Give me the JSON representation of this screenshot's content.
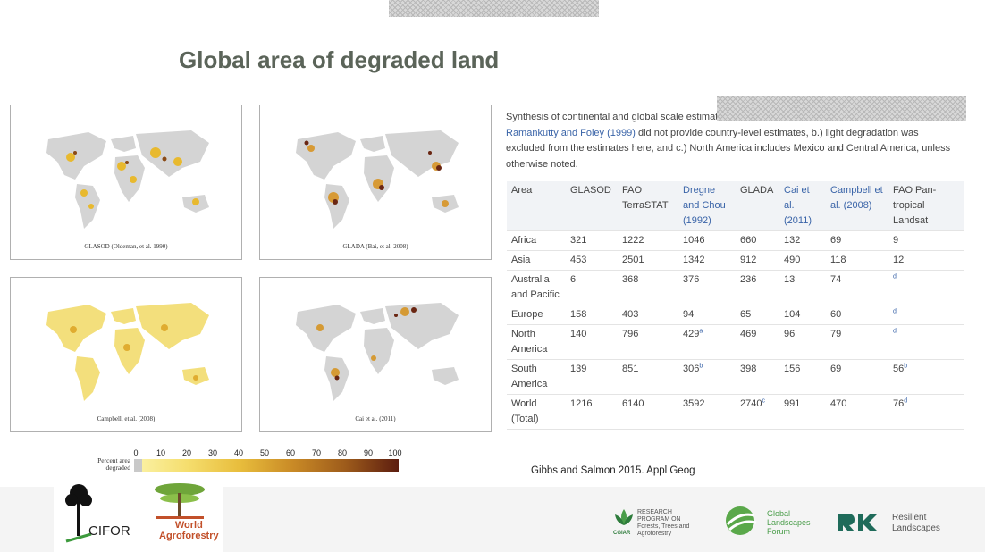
{
  "title": "Global area of degraded land",
  "maps": [
    {
      "label": "GLASOD (Oldeman, et al. 1990)"
    },
    {
      "label": "GLADA (Bai, et al. 2008)"
    },
    {
      "label": "Campbell, et al. (2008)"
    },
    {
      "label": "Cai et al. (2011)"
    }
  ],
  "legend": {
    "label": "Percent area degraded",
    "ticks": [
      "0",
      "10",
      "20",
      "30",
      "40",
      "50",
      "60",
      "70",
      "80",
      "90",
      "100"
    ],
    "colors": [
      "#c9c9c9",
      "#fbf3a8",
      "#e8bd3c",
      "#9d5b1b",
      "#5c1d0f"
    ]
  },
  "caption": {
    "part1": "Synthesis of continental and global scale estimat",
    "link": "Ramankutty and Foley (1999)",
    "part2": " did not provide country-level estimates, b.) light degradation was excluded from the estimates here, and c.) North America includes Mexico and Central America, unless otherwise noted."
  },
  "table": {
    "headers": [
      "Area",
      "GLASOD",
      "FAO TerraSTAT",
      "Dregne and Chou (1992)",
      "GLADA",
      "Cai et al. (2011)",
      "Campbell et al. (2008)",
      "FAO Pan-tropical Landsat"
    ],
    "rows": [
      {
        "area": "Africa",
        "glasod": "321",
        "fao": "1222",
        "dregne": "1046",
        "dregne_sup": "",
        "glada": "660",
        "glada_sup": "",
        "cai": "132",
        "campbell": "69",
        "landsat": "9",
        "landsat_sup": ""
      },
      {
        "area": "Asia",
        "glasod": "453",
        "fao": "2501",
        "dregne": "1342",
        "dregne_sup": "",
        "glada": "912",
        "glada_sup": "",
        "cai": "490",
        "campbell": "118",
        "landsat": "12",
        "landsat_sup": ""
      },
      {
        "area": "Australia and Pacific",
        "glasod": "6",
        "fao": "368",
        "dregne": "376",
        "dregne_sup": "",
        "glada": "236",
        "glada_sup": "",
        "cai": "13",
        "campbell": "74",
        "landsat": "",
        "landsat_sup": "d"
      },
      {
        "area": "Europe",
        "glasod": "158",
        "fao": "403",
        "dregne": "94",
        "dregne_sup": "",
        "glada": "65",
        "glada_sup": "",
        "cai": "104",
        "campbell": "60",
        "landsat": "",
        "landsat_sup": "d"
      },
      {
        "area": "North America",
        "glasod": "140",
        "fao": "796",
        "dregne": "429",
        "dregne_sup": "a",
        "glada": "469",
        "glada_sup": "",
        "cai": "96",
        "campbell": "79",
        "landsat": "",
        "landsat_sup": "d"
      },
      {
        "area": "South America",
        "glasod": "139",
        "fao": "851",
        "dregne": "306",
        "dregne_sup": "b",
        "glada": "398",
        "glada_sup": "",
        "cai": "156",
        "campbell": "69",
        "landsat": "56",
        "landsat_sup": "b"
      },
      {
        "area": "World (Total)",
        "glasod": "1216",
        "fao": "6140",
        "dregne": "3592",
        "dregne_sup": "",
        "glada": "2740",
        "glada_sup": "c",
        "cai": "991",
        "campbell": "470",
        "landsat": "76",
        "landsat_sup": "d"
      }
    ]
  },
  "citation": "Gibbs and Salmon 2015. Appl Geog",
  "footer": {
    "cifor": "CIFOR",
    "world_agroforestry": [
      "World",
      "Agroforestry"
    ],
    "cgiar_program": [
      "RESEARCH",
      "PROGRAM ON",
      "Forests, Trees and",
      "Agroforestry"
    ],
    "cgiar": "CGIAR",
    "glf": [
      "Global",
      "Landscapes",
      "Forum"
    ],
    "resilient": [
      "Resilient",
      "Landscapes"
    ]
  }
}
